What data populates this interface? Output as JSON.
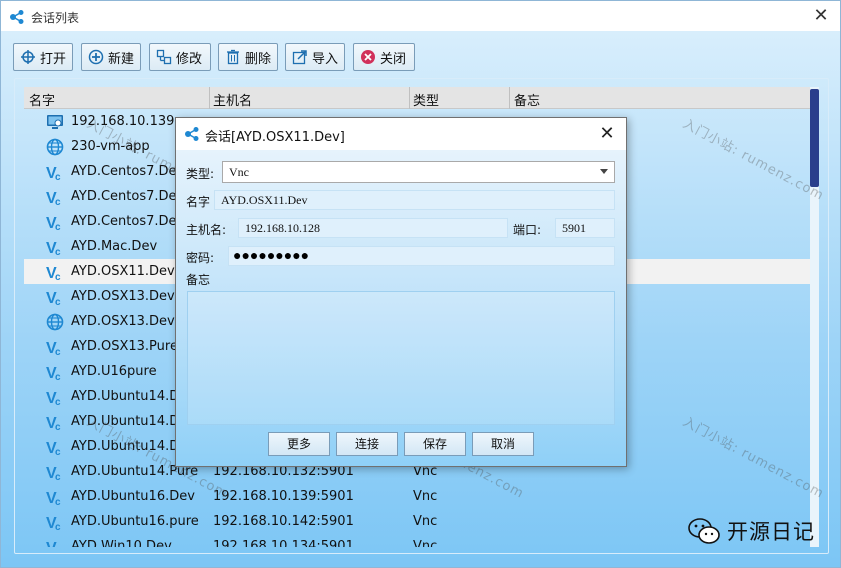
{
  "window": {
    "title": "会话列表",
    "close_glyph": "✕"
  },
  "toolbar": [
    {
      "label": "打开",
      "icon": "open-icon"
    },
    {
      "label": "新建",
      "icon": "add-icon"
    },
    {
      "label": "修改",
      "icon": "edit-icon"
    },
    {
      "label": "删除",
      "icon": "trash-icon"
    },
    {
      "label": "导入",
      "icon": "import-icon"
    },
    {
      "label": "关闭",
      "icon": "close-circle-icon"
    }
  ],
  "list": {
    "columns": [
      "名字",
      "主机名",
      "类型",
      "备忘"
    ],
    "rows": [
      {
        "name": "192.168.10.139",
        "host": "",
        "type": "",
        "icon": "rdp-icon"
      },
      {
        "name": "230-vm-app",
        "host": "",
        "type": "",
        "icon": "globe-icon"
      },
      {
        "name": "AYD.Centos7.Dev",
        "host": "",
        "type": "",
        "icon": "vnc-icon"
      },
      {
        "name": "AYD.Centos7.Dev.",
        "host": "",
        "type": "",
        "icon": "vnc-icon"
      },
      {
        "name": "AYD.Centos7.Dev.",
        "host": "",
        "type": "",
        "icon": "vnc-icon"
      },
      {
        "name": "AYD.Mac.Dev",
        "host": "",
        "type": "",
        "icon": "vnc-icon"
      },
      {
        "name": "AYD.OSX11.Dev",
        "host": "",
        "type": "",
        "icon": "vnc-icon",
        "selected": true
      },
      {
        "name": "AYD.OSX13.Dev",
        "host": "",
        "type": "",
        "icon": "vnc-icon"
      },
      {
        "name": "AYD.OSX13.Dev.SS",
        "host": "",
        "type": "",
        "icon": "globe-icon"
      },
      {
        "name": "AYD.OSX13.Pure",
        "host": "",
        "type": "",
        "icon": "vnc-icon"
      },
      {
        "name": "AYD.U16pure",
        "host": "",
        "type": "",
        "icon": "vnc-icon"
      },
      {
        "name": "AYD.Ubuntu14.Dev",
        "host": "",
        "type": "",
        "icon": "vnc-icon"
      },
      {
        "name": "AYD.Ubuntu14.Dev",
        "host": "",
        "type": "",
        "icon": "vnc-icon"
      },
      {
        "name": "AYD.Ubuntu14.Dev",
        "host": "",
        "type": "",
        "icon": "vnc-icon"
      },
      {
        "name": "AYD.Ubuntu14.Pure",
        "host": "192.168.10.132:5901",
        "type": "Vnc",
        "icon": "vnc-icon"
      },
      {
        "name": "AYD.Ubuntu16.Dev",
        "host": "192.168.10.139:5901",
        "type": "Vnc",
        "icon": "vnc-icon"
      },
      {
        "name": "AYD.Ubuntu16.pure",
        "host": "192.168.10.142:5901",
        "type": "Vnc",
        "icon": "vnc-icon"
      },
      {
        "name": "AYD.Win10.Dev",
        "host": "192.168.10.134:5901",
        "type": "Vnc",
        "icon": "vnc-icon"
      }
    ]
  },
  "dialog": {
    "title": "会话[AYD.OSX11.Dev]",
    "type_label": "类型:",
    "type_value": "Vnc",
    "name_label": "名字",
    "name_value": "AYD.OSX11.Dev",
    "host_label": "主机名:",
    "host_value": "192.168.10.128",
    "port_label": "端口:",
    "port_value": "5901",
    "password_label": "密码:",
    "password_mask": "●●●●●●●●●",
    "notes_label": "备忘",
    "buttons": [
      "更多",
      "连接",
      "保存",
      "取消"
    ]
  },
  "watermark": {
    "text": "入门小站: rumenz.com"
  },
  "brand": {
    "text": "开源日记",
    "icon": "wechat-icon"
  },
  "colors": {
    "accent": "#1e88d2",
    "scroll_thumb": "#2a3e8c",
    "close_icon": "#d1305a"
  }
}
